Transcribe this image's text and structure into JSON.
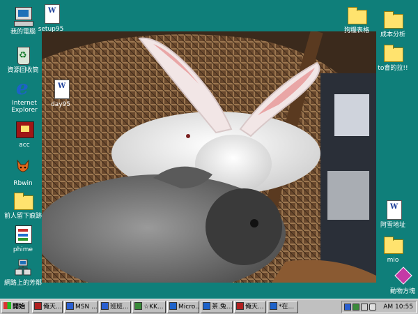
{
  "desktop": {
    "icons_left": [
      {
        "label": "我的電腦",
        "icon": "my-computer-icon"
      },
      {
        "label": "資源回收筒",
        "icon": "recycle-bin-icon"
      },
      {
        "label": "Internet Explorer",
        "icon": "internet-explorer-icon"
      },
      {
        "label": "acc",
        "icon": "acc-app-icon"
      },
      {
        "label": "Rbwin",
        "icon": "rbwin-fox-icon"
      },
      {
        "label": "前人留下痕跡",
        "icon": "folder-icon"
      },
      {
        "label": "phime",
        "icon": "phime-icon"
      },
      {
        "label": "網路上的芳鄰",
        "icon": "network-neighborhood-icon"
      }
    ],
    "icons_col2": [
      {
        "label": "setup95",
        "icon": "setup-document-icon"
      },
      {
        "label": "day95",
        "icon": "word-document-icon"
      }
    ],
    "icons_right": [
      {
        "label": "狗糧表格",
        "icon": "folder-icon"
      },
      {
        "label": "成本分析",
        "icon": "folder-icon"
      },
      {
        "label": "to會的拉!!",
        "icon": "folder-icon"
      },
      {
        "label": "阿雪地址",
        "icon": "word-document-icon"
      },
      {
        "label": "mio",
        "icon": "folder-icon"
      },
      {
        "label": "動物方塊",
        "icon": "animal-cube-icon"
      }
    ]
  },
  "taskbar": {
    "start_label": "開始",
    "buttons": [
      {
        "label": "俺天...",
        "icon_color": "#b02020"
      },
      {
        "label": "MSN ...",
        "icon_color": "#2a5fd0"
      },
      {
        "label": "班班...",
        "icon_color": "#2a5fd0"
      },
      {
        "label": "☆KK...",
        "icon_color": "#3a8a3a"
      },
      {
        "label": "Micro...",
        "icon_color": "#1d62c9"
      },
      {
        "label": "茶.兔...",
        "icon_color": "#1d62c9"
      },
      {
        "label": "俺天...",
        "icon_color": "#b02020"
      },
      {
        "label": "*在...",
        "icon_color": "#1d62c9"
      }
    ],
    "tray": {
      "time": "AM 10:55"
    }
  },
  "colors": {
    "desktop_bg": "#0f7f7a",
    "taskbar_bg": "#c0c0c0"
  }
}
